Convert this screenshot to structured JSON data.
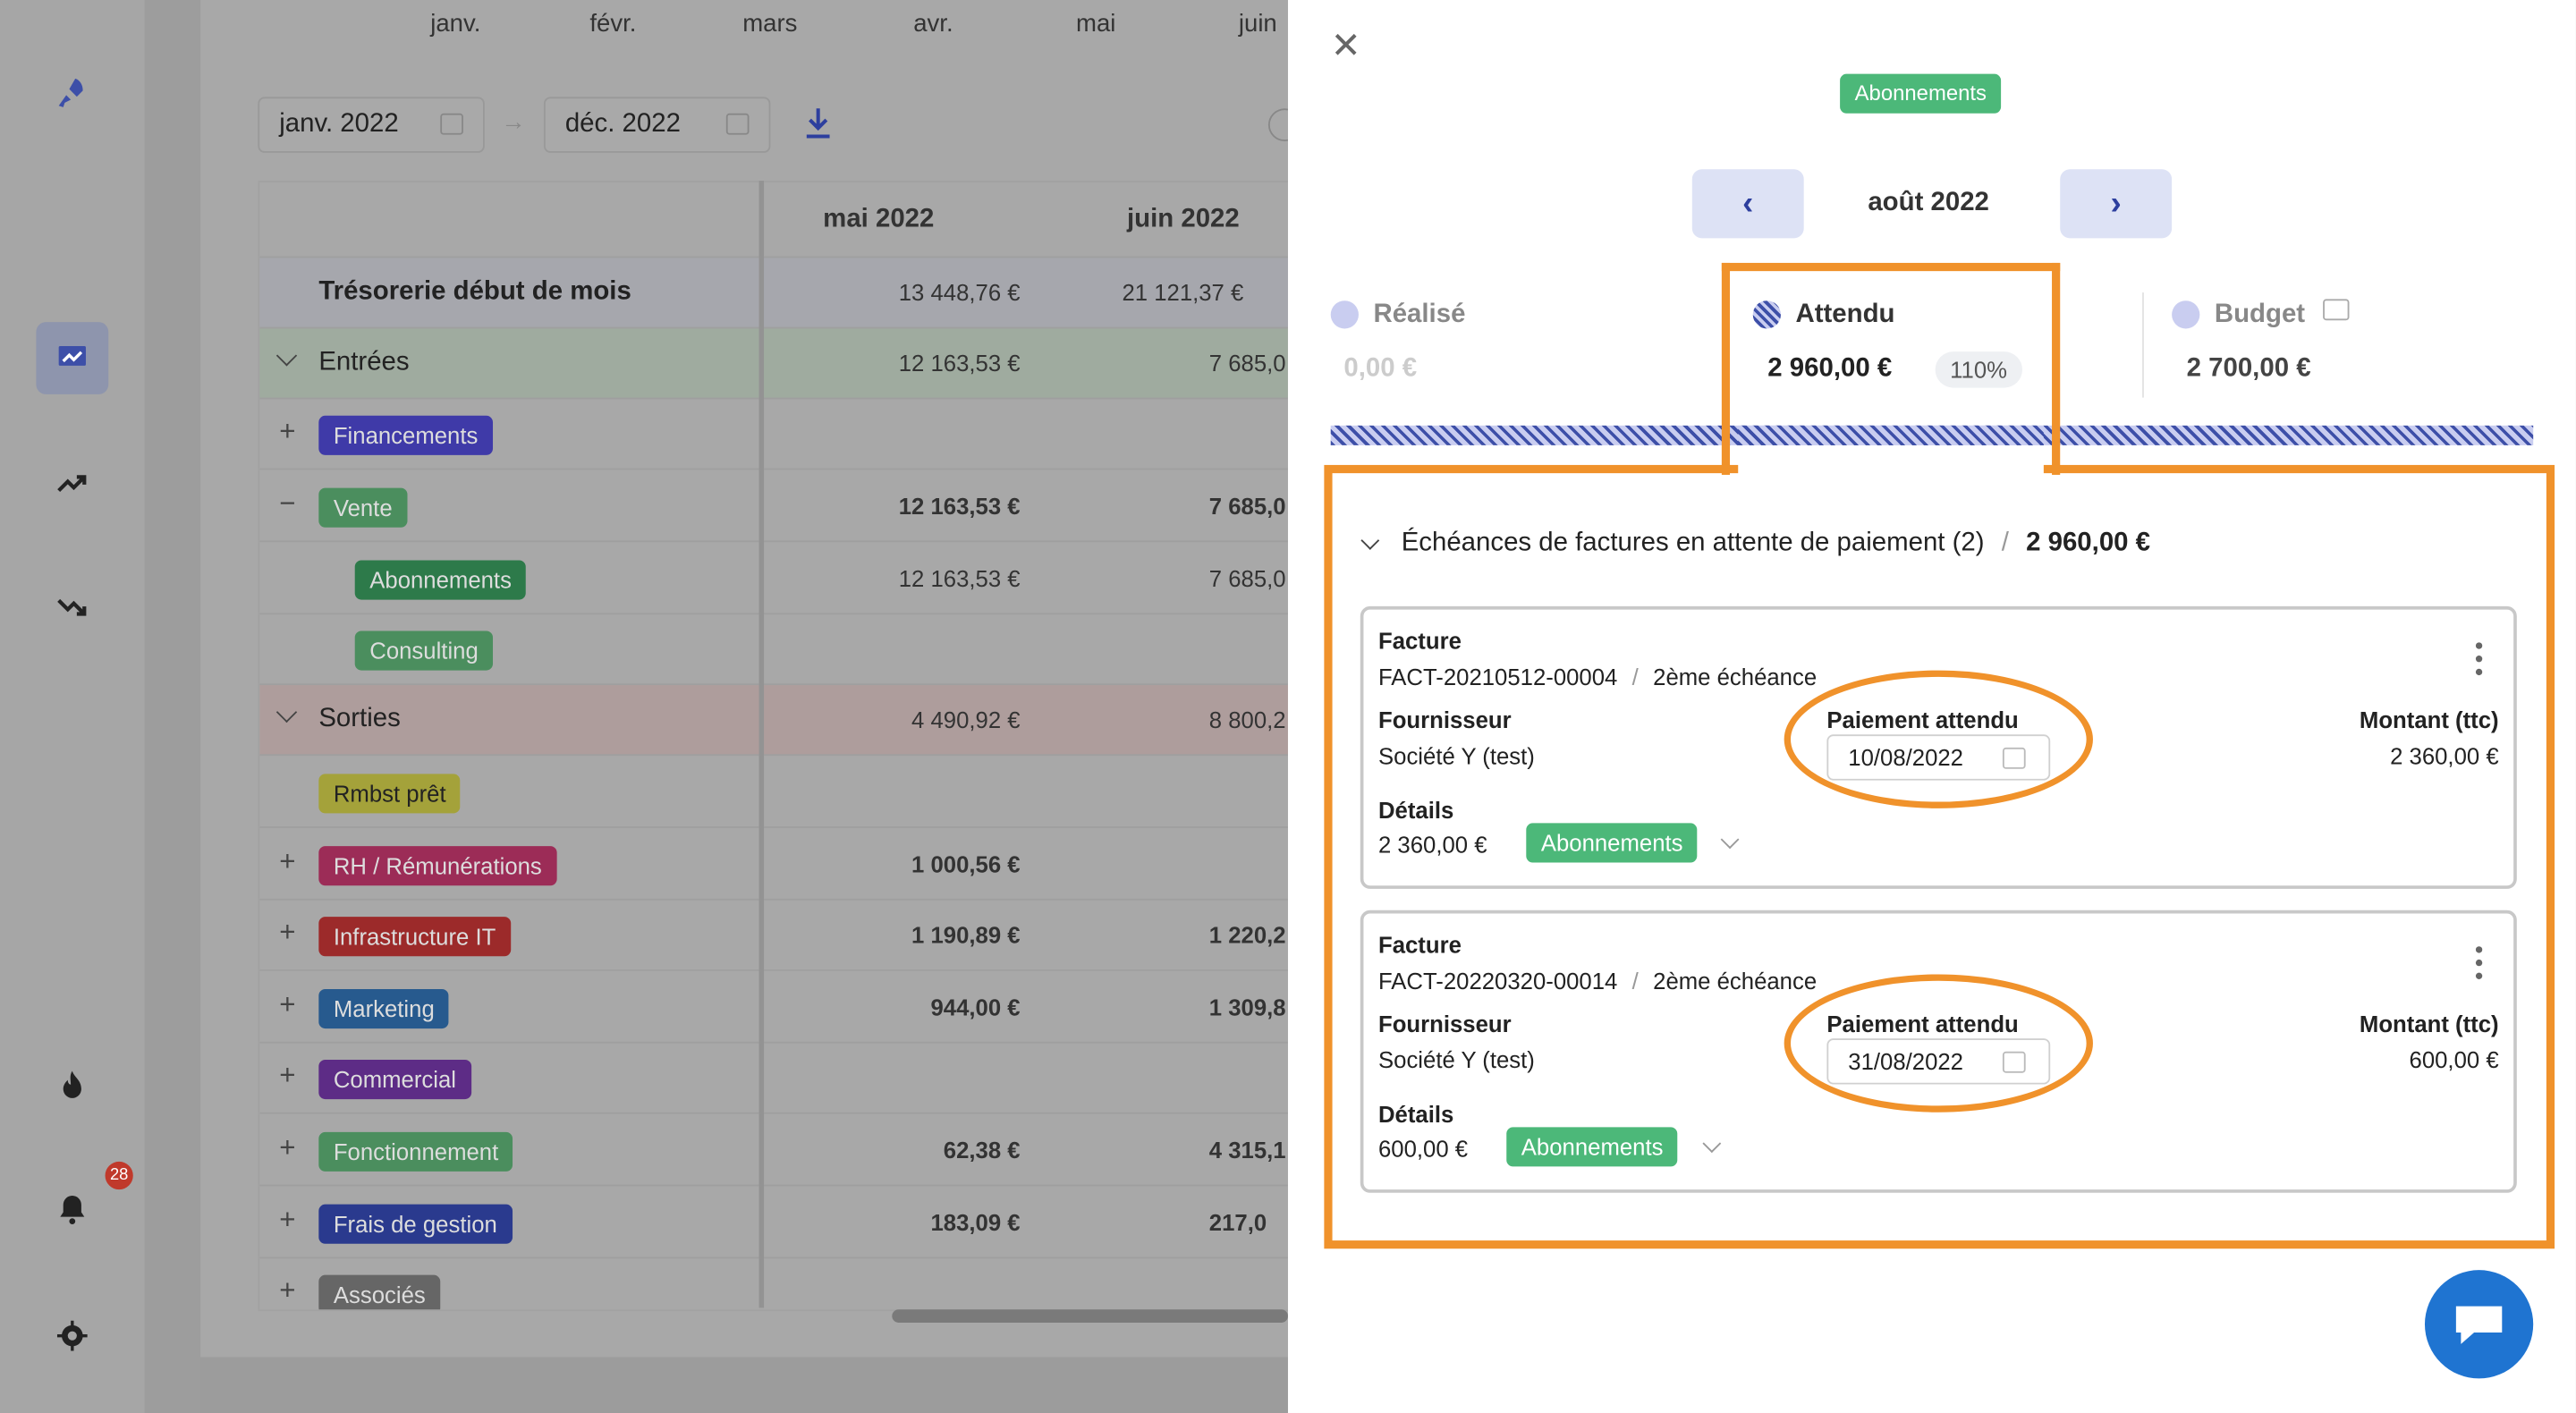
{
  "months_header": [
    "janv.",
    "févr.",
    "mars",
    "avr.",
    "mai",
    "juin"
  ],
  "filters": {
    "start": "janv. 2022",
    "end": "déc. 2022"
  },
  "table": {
    "columns": [
      "mai 2022",
      "juin 2022"
    ],
    "rows": [
      {
        "label": "Trésorerie début de mois",
        "v1": "13 448,76 €",
        "v2": "21 121,37 €"
      },
      {
        "label": "Entrées",
        "v1": "12 163,53 €",
        "v2": "7 685,0"
      },
      {
        "label": "Financements",
        "v1": "",
        "v2": ""
      },
      {
        "label": "Vente",
        "v1": "12 163,53 €",
        "v2": "7 685,0"
      },
      {
        "label": "Abonnements",
        "v1": "12 163,53 €",
        "v2": "7 685,0"
      },
      {
        "label": "Consulting",
        "v1": "",
        "v2": ""
      },
      {
        "label": "Sorties",
        "v1": "4 490,92 €",
        "v2": "8 800,2"
      },
      {
        "label": "Rmbst prêt",
        "v1": "",
        "v2": ""
      },
      {
        "label": "RH / Rémunérations",
        "v1": "1 000,56 €",
        "v2": ""
      },
      {
        "label": "Infrastructure IT",
        "v1": "1 190,89 €",
        "v2": "1 220,2"
      },
      {
        "label": "Marketing",
        "v1": "944,00 €",
        "v2": "1 309,8"
      },
      {
        "label": "Commercial",
        "v1": "",
        "v2": ""
      },
      {
        "label": "Fonctionnement",
        "v1": "62,38 €",
        "v2": "4 315,1"
      },
      {
        "label": "Frais de gestion",
        "v1": "183,09 €",
        "v2": "217,0"
      },
      {
        "label": "Associés",
        "v1": "",
        "v2": ""
      }
    ]
  },
  "sidebar": {
    "notification_count": "28"
  },
  "panel": {
    "category_tag": "Abonnements",
    "period": "août 2022",
    "metrics": {
      "realise_label": "Réalisé",
      "realise_value": "0,00 €",
      "attendu_label": "Attendu",
      "attendu_value": "2 960,00 €",
      "attendu_pct": "110%",
      "budget_label": "Budget",
      "budget_value": "2 700,00 €"
    },
    "section": {
      "title": "Échéances de factures en attente de paiement (2)",
      "sep": "/",
      "total": "2 960,00 €"
    },
    "invoices": [
      {
        "type_label": "Facture",
        "ref": "FACT-20210512-00004",
        "sep": "/",
        "installment": "2ème échéance",
        "supplier_label": "Fournisseur",
        "supplier": "Société Y (test)",
        "payment_label": "Paiement attendu",
        "payment_date": "10/08/2022",
        "amount_label": "Montant (ttc)",
        "amount": "2 360,00 €",
        "details_label": "Détails",
        "details_amount": "2 360,00 €",
        "details_tag": "Abonnements"
      },
      {
        "type_label": "Facture",
        "ref": "FACT-20220320-00014",
        "sep": "/",
        "installment": "2ème échéance",
        "supplier_label": "Fournisseur",
        "supplier": "Société Y (test)",
        "payment_label": "Paiement attendu",
        "payment_date": "31/08/2022",
        "amount_label": "Montant (ttc)",
        "amount": "600,00 €",
        "details_label": "Détails",
        "details_amount": "600,00 €",
        "details_tag": "Abonnements"
      }
    ]
  },
  "colors": {
    "accent": "#f0922b",
    "green_tag": "#4cb879",
    "brand_blue": "#2d3f9e",
    "chat": "#1f74d1"
  }
}
